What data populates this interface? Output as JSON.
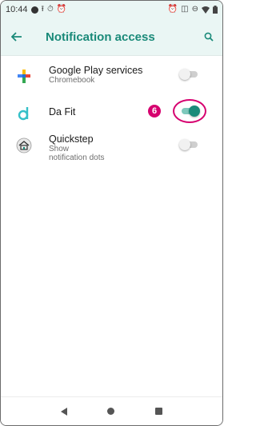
{
  "status_bar": {
    "time": "10:44",
    "icons_left": [
      "notification-dot-icon",
      "upload-icon",
      "timer-icon",
      "alarm-icon"
    ],
    "icons_right": [
      "alarm-icon",
      "vibrate-icon",
      "dnd-icon",
      "wifi-icon",
      "battery-icon"
    ]
  },
  "app_bar": {
    "title": "Notification access",
    "back_icon": "arrow-left-icon",
    "search_icon": "search-icon"
  },
  "apps": [
    {
      "name": "Google Play services",
      "subtitle": "Chromebook",
      "icon": "google-play-services-icon",
      "enabled": false
    },
    {
      "name": "Da Fit",
      "subtitle": "",
      "icon": "da-fit-icon",
      "enabled": true
    },
    {
      "name": "Quickstep",
      "subtitle_lines": [
        "Show",
        "notification dots"
      ],
      "icon": "quickstep-home-icon",
      "enabled": false
    }
  ],
  "callout": {
    "number": "6",
    "color": "#d6006f"
  },
  "colors": {
    "accent": "#1a8a79",
    "header_bg": "#eaf6f4"
  },
  "nav_bar": {
    "icons": [
      "back-icon",
      "home-icon",
      "recents-icon"
    ]
  }
}
